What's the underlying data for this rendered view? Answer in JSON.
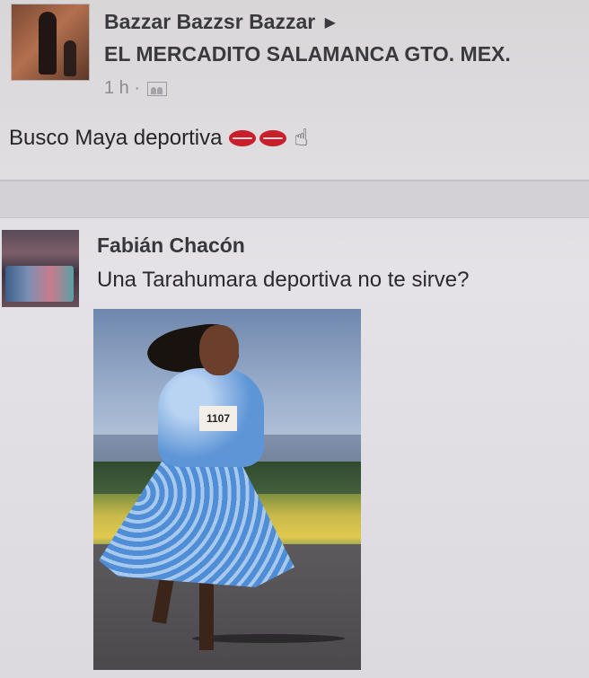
{
  "post": {
    "author": "Bazzar Bazzsr Bazzar",
    "group": "EL MERCADITO SALAMANCA GTO. MEX.",
    "time": "1 h ·",
    "text": "Busco Maya deportiva"
  },
  "comment": {
    "author": "Fabián Chacón",
    "text": "Una Tarahumara deportiva no te sirve?",
    "photo_bib": "1107"
  },
  "icons": {
    "arrow": "right-triangle-icon",
    "audience": "group-icon",
    "lips": "kiss-lips-icon",
    "hand": "ok-hand-icon"
  }
}
